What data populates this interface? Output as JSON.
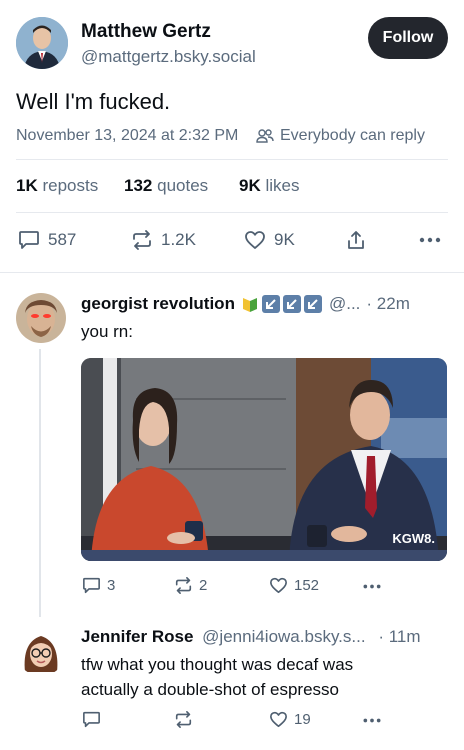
{
  "post": {
    "author_name": "Matthew Gertz",
    "author_handle": "@mattgertz.bsky.social",
    "follow_label": "Follow",
    "text": "Well I'm fucked.",
    "timestamp": "November 13, 2024 at 2:32 PM",
    "reply_setting": "Everybody can reply",
    "stats": {
      "reposts_count": "1K",
      "reposts_label": "reposts",
      "quotes_count": "132",
      "quotes_label": "quotes",
      "likes_count": "9K",
      "likes_label": "likes"
    },
    "actions": {
      "replies": "587",
      "reposts": "1.2K",
      "likes": "9K"
    }
  },
  "replies": [
    {
      "author_name": "georgist revolution",
      "handle": "@...",
      "time": "· 22m",
      "text": "you rn:",
      "image_overlay": "KGW8.",
      "actions": {
        "replies": "3",
        "reposts": "2",
        "likes": "152"
      }
    },
    {
      "author_name": "Jennifer Rose",
      "handle": "@jenni4iowa.bsky.s...",
      "time": "· 11m",
      "text_line1": "tfw what you thought was decaf was",
      "text_line2": "actually a double-shot of espresso",
      "actions": {
        "likes": "19"
      }
    }
  ],
  "colors": {
    "follow_bg": "#23262d",
    "muted": "#5b6b7d",
    "badge_green": "#8cc63f",
    "badge_blue": "#5d7fa8"
  },
  "icons": [
    "people-icon",
    "reply-icon",
    "repost-icon",
    "heart-icon",
    "share-icon",
    "more-icon"
  ]
}
